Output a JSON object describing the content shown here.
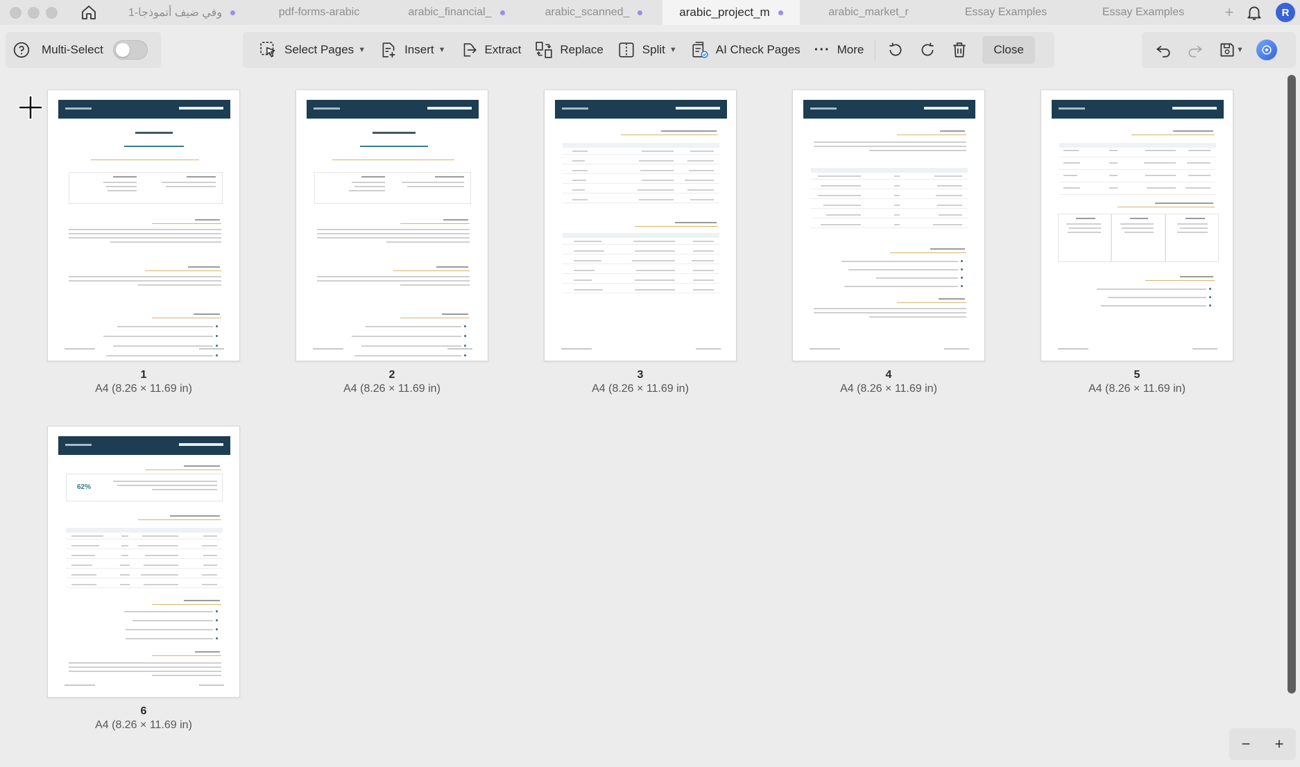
{
  "window": {
    "tabs": [
      {
        "label": "وفي ضيف أتموذجا-1",
        "active": false
      },
      {
        "label": "pdf-forms-arabic",
        "active": false
      },
      {
        "label": "arabic_financial_",
        "active": false
      },
      {
        "label": "arabic_scanned_",
        "active": false
      },
      {
        "label": "arabic_project_m",
        "active": true
      },
      {
        "label": "arabic_market_r",
        "active": false
      },
      {
        "label": "Essay Examples",
        "active": false
      },
      {
        "label": "Essay Examples",
        "active": false
      }
    ],
    "tab_add": "+",
    "avatar_initial": "R"
  },
  "toolbar": {
    "multi_select_label": "Multi-Select",
    "multi_select_on": false,
    "select_pages_label": "Select Pages",
    "insert_label": "Insert",
    "extract_label": "Extract",
    "replace_label": "Replace",
    "split_label": "Split",
    "ai_check_label": "AI Check Pages",
    "more_label": "More",
    "close_label": "Close"
  },
  "pages": [
    {
      "number": "1",
      "size": "A4 (8.26 × 11.69 in)"
    },
    {
      "number": "2",
      "size": "A4 (8.26 × 11.69 in)"
    },
    {
      "number": "3",
      "size": "A4 (8.26 × 11.69 in)"
    },
    {
      "number": "4",
      "size": "A4 (8.26 × 11.69 in)"
    },
    {
      "number": "5",
      "size": "A4 (8.26 × 11.69 in)"
    },
    {
      "number": "6",
      "size": "A4 (8.26 × 11.69 in)"
    }
  ],
  "page6_progress": "62%",
  "zoom": {
    "minus": "−",
    "plus": "+"
  },
  "colors": {
    "doc_header": "#1c3d52",
    "accent_dot": "#9b8cf0",
    "avatar": "#3a62d8"
  }
}
